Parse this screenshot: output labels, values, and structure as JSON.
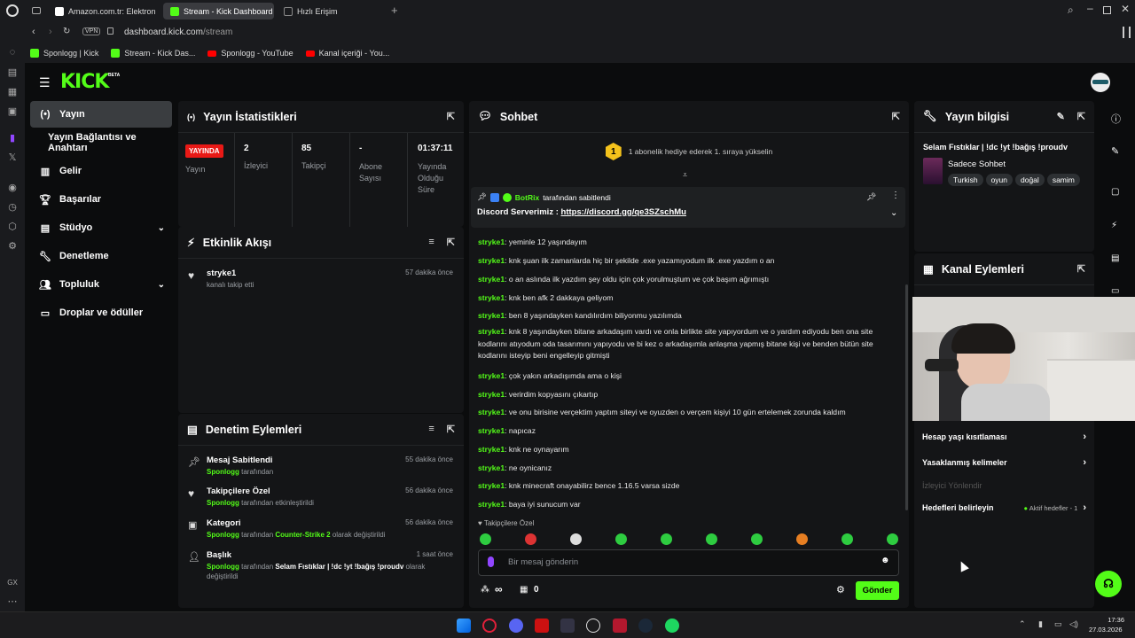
{
  "browser": {
    "tabs": [
      {
        "label": "Amazon.com.tr: Elektronik",
        "color": "#ffffff"
      },
      {
        "label": "Stream - Kick Dashboard",
        "color": "#53fc18"
      },
      {
        "label": "Hızlı Erişim",
        "color": "#888888"
      }
    ],
    "vpn": "VPN",
    "url_domain": "dashboard.kick.com",
    "url_path": "/stream",
    "url_prefix": "",
    "bookmarks": [
      "Sponlogg | Kick",
      "Stream - Kick Das...",
      "Sponlogg - YouTube",
      "Kanal içeriği - You..."
    ]
  },
  "kick": {
    "logo": "KICK",
    "beta": "BETA"
  },
  "leftnav": {
    "items": [
      {
        "label": "Yayın",
        "icon": "broadcast-icon"
      },
      {
        "label": "Yayın Bağlantısı ve Anahtarı",
        "icon": "key-icon"
      },
      {
        "label": "Gelir",
        "icon": "bar-chart-icon"
      },
      {
        "label": "Başarılar",
        "icon": "trophy-icon"
      },
      {
        "label": "Stüdyo",
        "icon": "studio-icon"
      },
      {
        "label": "Denetleme",
        "icon": "wrench-icon"
      },
      {
        "label": "Topluluk",
        "icon": "users-icon"
      },
      {
        "label": "Droplar ve ödüller",
        "icon": "gift-icon"
      }
    ]
  },
  "stats": {
    "title": "Yayın İstatistikleri",
    "live_badge": "YAYINDA",
    "live_label": "Yayın",
    "items": [
      {
        "value": "2",
        "label": "İzleyici"
      },
      {
        "value": "85",
        "label": "Takipçi"
      },
      {
        "value": "-",
        "label": "Abone Sayısı"
      },
      {
        "value": "01:37:11",
        "label": "Yayında Olduğu Süre"
      }
    ]
  },
  "activity": {
    "title": "Etkinlik Akışı",
    "items": [
      {
        "user": "stryke1",
        "desc": "kanalı takip etti",
        "time": "57 dakika önce"
      }
    ]
  },
  "moderation": {
    "title": "Denetim Eylemleri",
    "items": [
      {
        "title": "Mesaj Sabitlendi",
        "user": "Sponlogg",
        "rest": " tarafından",
        "extra": "",
        "tail": "",
        "time": "55 dakika önce"
      },
      {
        "title": "Takipçilere Özel",
        "user": "Sponlogg",
        "rest": " tarafından etkinleştirildi",
        "extra": "",
        "tail": "",
        "time": "56 dakika önce"
      },
      {
        "title": "Kategori",
        "user": "Sponlogg",
        "rest": " tarafından ",
        "extra": "Counter-Strike 2",
        "tail": " olarak değiştirildi",
        "time": "56 dakika önce"
      },
      {
        "title": "Başlık",
        "user": "Sponlogg",
        "rest": " tarafından ",
        "extra": "Selam Fıstıklar | !dc !yt !bağış !proudv",
        "tail": " olarak değiştirildi",
        "time": "1 saat önce"
      }
    ]
  },
  "chat": {
    "title": "Sohbet",
    "sub_goal_count": "1",
    "sub_goal_text": "1 abonelik hediye ederek 1. sıraya yükselin",
    "pinned_by": "BotRix",
    "pinned_suffix": "tarafından sabitlendi",
    "pinned_text": "Discord Serverimiz : ",
    "pinned_link": "https://discord.gg/qe3SZschMu",
    "messages": [
      {
        "user": "stryke1",
        "text": "yeminle 12 yaşındayım"
      },
      {
        "user": "stryke1",
        "text": "knk şuan ilk zamanlarda hiç bir şekilde .exe yazamıyodum ilk .exe yazdım o an"
      },
      {
        "user": "stryke1",
        "text": "o an aslında ilk yazdım şey oldu için çok yorulmuştum ve çok başım ağrımıştı"
      },
      {
        "user": "stryke1",
        "text": "knk ben afk 2 dakkaya geliyom"
      },
      {
        "user": "stryke1",
        "text": "ben 8 yaşındayken kandılırdım biliyonmu yazılımda"
      },
      {
        "user": "stryke1",
        "text": "knk 8 yaşındayken bitane arkadaşım vardı ve onla birlikte site yapıyordum ve o yardım ediyodu ben ona site kodlarını atıyodum oda tasarımını yapıyodu ve bi kez o arkadaşımla anlaşma yapmış bitane kişi ve benden bütün site kodlarını isteyip beni engelleyip gitmişti"
      },
      {
        "user": "stryke1",
        "text": "çok yakın arkadışımda ama o kişi"
      },
      {
        "user": "stryke1",
        "text": "verirdim kopyasını çıkartıp"
      },
      {
        "user": "stryke1",
        "text": "ve onu birisine verçektim yaptım siteyi ve oyuzden o verçem kişiyi 10 gün ertelemek zorunda kaldım"
      },
      {
        "user": "stryke1",
        "text": "napıcaz"
      },
      {
        "user": "stryke1",
        "text": "knk ne oynayarım"
      },
      {
        "user": "stryke1",
        "text": "ne oynicanız"
      },
      {
        "user": "stryke1",
        "text": "knk minecraft onayabilirz bence 1.16.5 varsa sizde"
      },
      {
        "user": "stryke1",
        "text": "baya iyi sunucum var"
      }
    ],
    "followers_only": "Takipçilere Özel",
    "input_placeholder": "Bir mesaj gönderin",
    "infinity": "∞",
    "points": "0",
    "send": "Gönder"
  },
  "info": {
    "title": "Yayın bilgisi",
    "stream_title": "Selam Fıstıklar | !dc !yt !bağış !proudv",
    "category": "Sadece Sohbet",
    "tags": [
      "Turkish",
      "oyun",
      "doğal",
      "samim"
    ]
  },
  "channel_actions": {
    "title": "Kanal Eylemleri",
    "rows": [
      {
        "label": "Hesap yaşı kısıtlaması"
      },
      {
        "label": "Yasaklanmış kelimeler"
      }
    ],
    "viewer_redirect": "İzleyici Yönlendir",
    "goals_label": "Hedefleri belirleyin",
    "goals_status": "Aktif hedefler - 1"
  },
  "taskbar": {
    "time": "17:36",
    "date": "27.03.2026"
  },
  "colors": {
    "accent": "#53fc18",
    "live": "#e91916"
  }
}
